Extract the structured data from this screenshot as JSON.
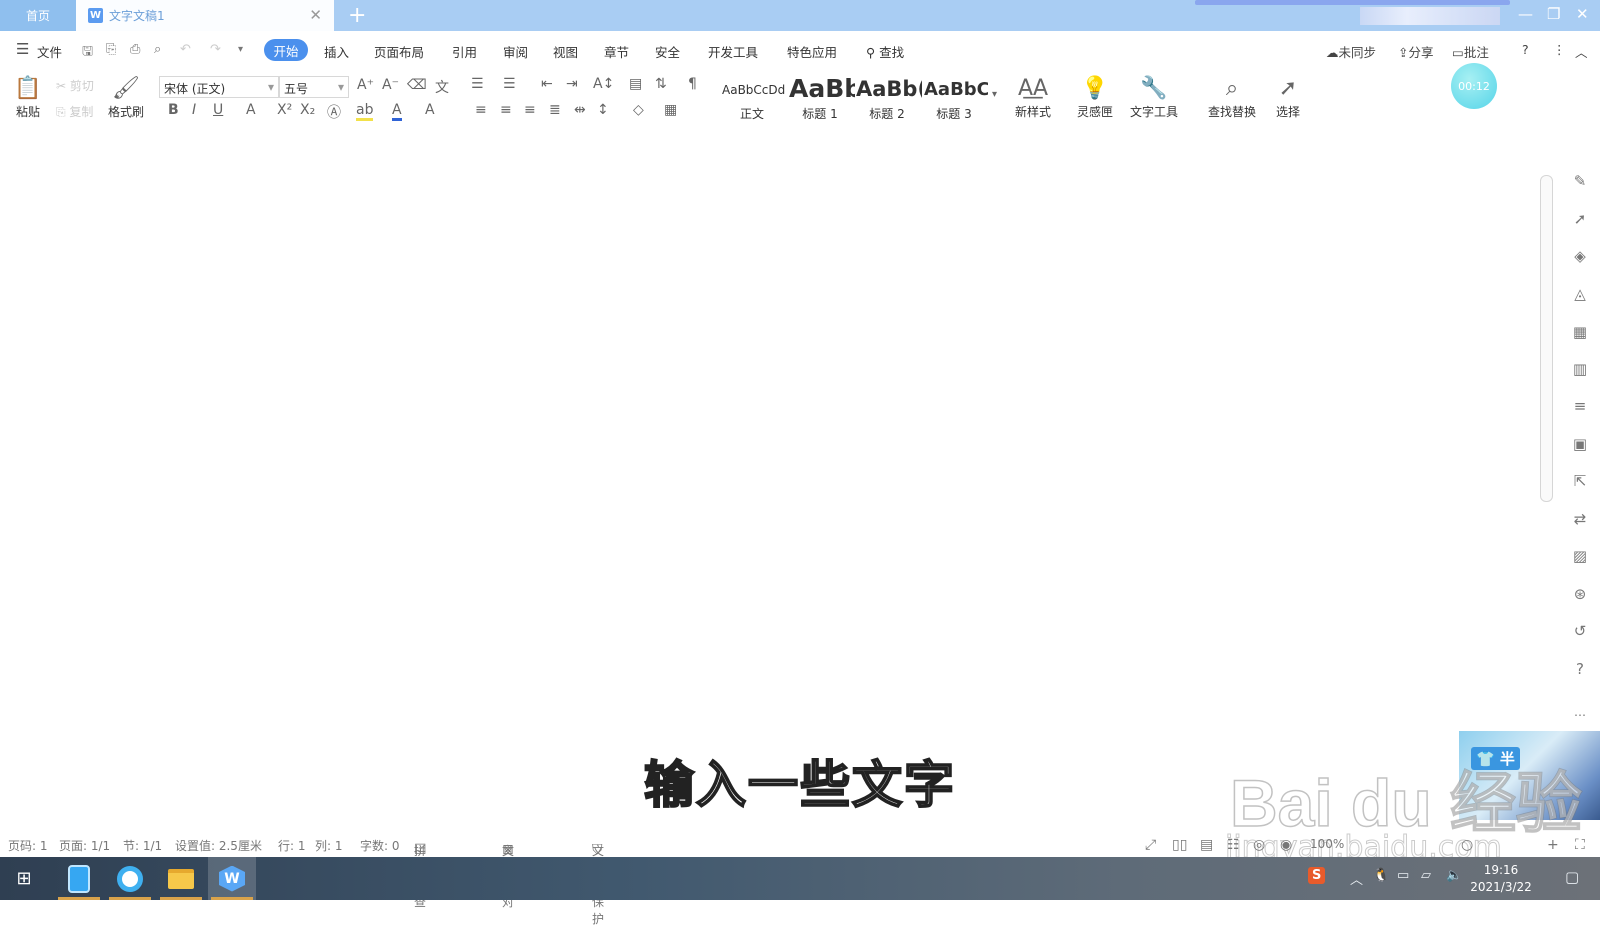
{
  "titlebar": {
    "home_tab": "首页",
    "doc_tab": "文字文稿1",
    "doc_icon": "W",
    "close_glyph": "✕",
    "new_tab_glyph": "+",
    "min_glyph": "—",
    "restore_glyph": "❐",
    "close_win_glyph": "✕"
  },
  "menu": {
    "file": "文件",
    "tabs": [
      "开始",
      "插入",
      "页面布局",
      "引用",
      "审阅",
      "视图",
      "章节",
      "安全",
      "开发工具",
      "特色应用"
    ],
    "search": "查找",
    "sync": "未同步",
    "share": "分享",
    "comment": "批注"
  },
  "ribbon": {
    "paste": "粘贴",
    "cut": "剪切",
    "copy": "复制",
    "format_painter": "格式刷",
    "font_name": "宋体 (正文)",
    "font_size": "五号",
    "styles": [
      {
        "preview": "AaBbCcDd",
        "label": "正文"
      },
      {
        "preview": "AaBb",
        "label": "标题 1"
      },
      {
        "preview": "AaBb(",
        "label": "标题 2"
      },
      {
        "preview": "AaBbCc",
        "label": "标题 3"
      }
    ],
    "new_style": "新样式",
    "inspiration": "灵感匣",
    "text_tools": "文字工具",
    "find_replace": "查找替换",
    "select": "选择",
    "timer": "00:12"
  },
  "document": {
    "subtitle": "输入一些文字"
  },
  "watermark": {
    "brand": "Bai du 经验",
    "url": "jingyan.baidu.com",
    "badge": "半"
  },
  "statusbar": {
    "page_no": "页码: 1",
    "pages": "页面: 1/1",
    "section": "节: 1/1",
    "setting": "设置值: 2.5厘米",
    "row": "行: 1",
    "col": "列: 1",
    "word_count": "字数: 0",
    "spell_check": "拼写检查",
    "doc_check": "文档校对",
    "protect": "文档未保护",
    "zoom": "100%"
  },
  "taskbar": {
    "time": "19:16",
    "date": "2021/3/22"
  },
  "colors": {
    "titlebar": "#a9cdf3",
    "active_tab": "#4b90ed",
    "taskbar": "#41596f"
  }
}
